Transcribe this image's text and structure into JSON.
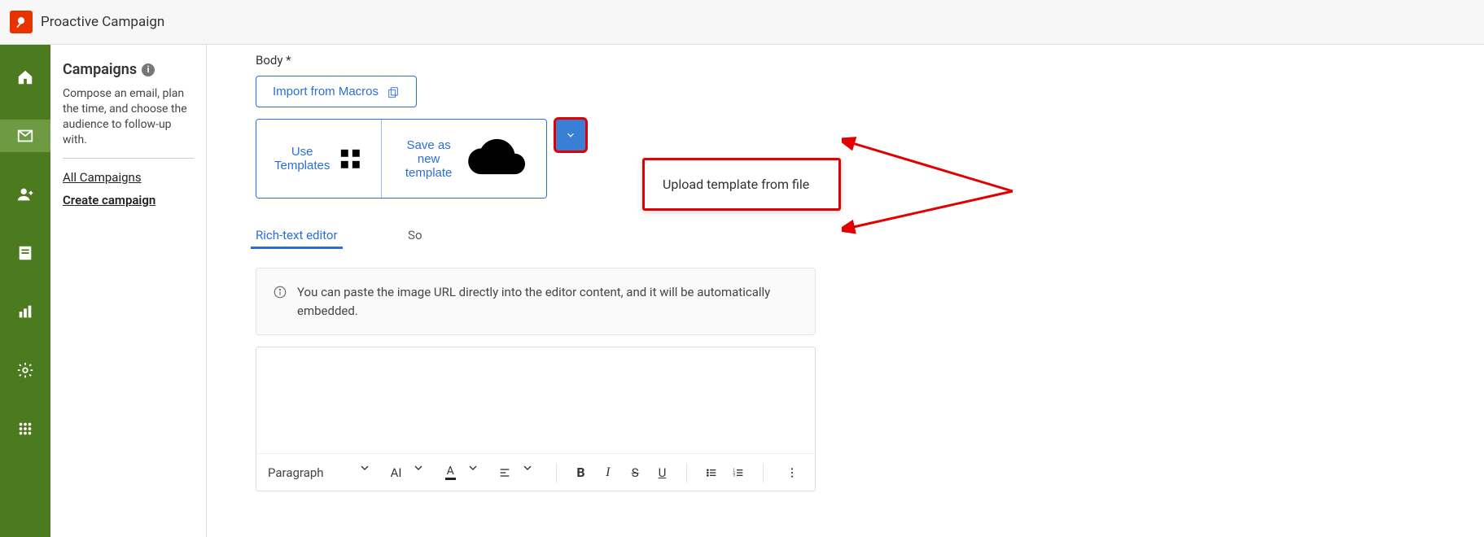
{
  "header": {
    "title": "Proactive Campaign"
  },
  "sidepanel": {
    "title": "Campaigns",
    "description": "Compose an email, plan the time, and choose the audience to follow-up with.",
    "link_all": "All Campaigns",
    "link_create": "Create campaign"
  },
  "body": {
    "label": "Body *",
    "import_btn": "Import from Macros",
    "templates_btn": "Use Templates",
    "save_template_btn": "Save as new template",
    "dropdown_item": "Upload template from file",
    "tab_rich": "Rich-text editor",
    "tab_source": "Source",
    "hint": "You can paste the image URL directly into the editor content, and it will be automatically embedded."
  },
  "toolbar": {
    "paragraph": "Paragraph",
    "font_glyph": "AI",
    "color_glyph": "A",
    "bold": "B",
    "italic": "I",
    "strike": "S",
    "underline": "U"
  }
}
